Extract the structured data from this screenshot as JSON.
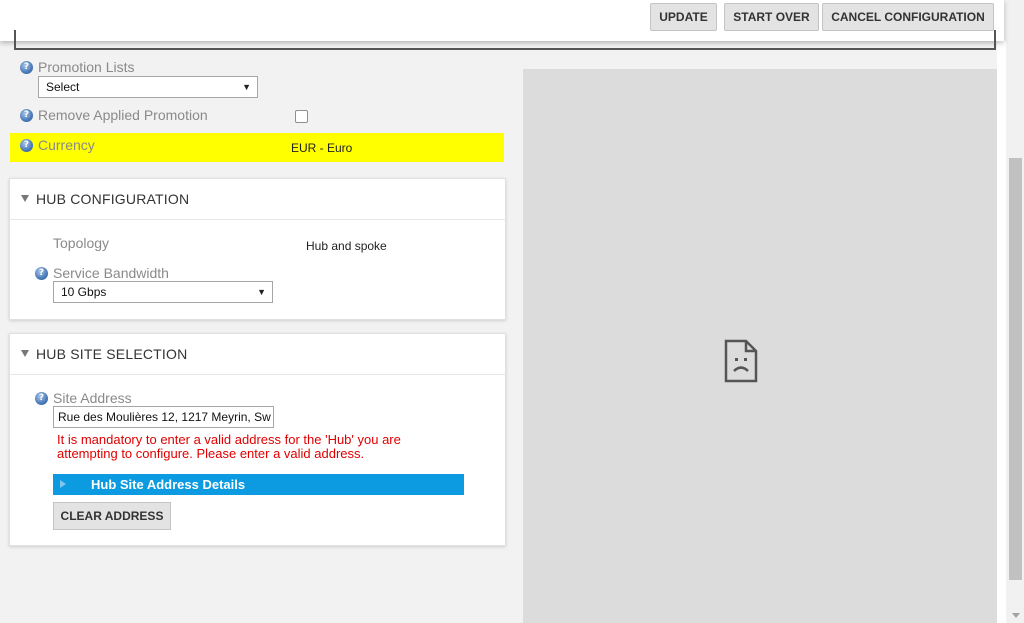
{
  "toolbar": {
    "update_label": "UPDATE",
    "start_over_label": "START OVER",
    "cancel_label": "CANCEL CONFIGURATION"
  },
  "promotion": {
    "promotion_lists_label": "Promotion Lists",
    "promotion_lists_value": "Select",
    "remove_applied_label": "Remove Applied Promotion",
    "remove_applied_checked": false
  },
  "currency": {
    "label": "Currency",
    "value": "EUR - Euro",
    "highlight_color": "#ffff00"
  },
  "hub_configuration": {
    "title": "HUB CONFIGURATION",
    "topology_label": "Topology",
    "topology_value": "Hub and spoke",
    "bandwidth_label": "Service Bandwidth",
    "bandwidth_value": "10 Gbps"
  },
  "hub_site_selection": {
    "title": "HUB SITE SELECTION",
    "site_address_label": "Site Address",
    "site_address_value": "Rue des Moulières 12, 1217 Meyrin, Sw",
    "error_line1": "It is mandatory to enter a valid address for the 'Hub' you are",
    "error_line2": "attempting to configure. Please enter a valid address.",
    "details_label": "Hub Site Address Details",
    "clear_address_label": "CLEAR ADDRESS",
    "error_color": "#e00000",
    "accent_color": "#0c9be0"
  },
  "icons": {
    "help": "help-icon",
    "dropdown": "chevron-down-icon",
    "collapse": "collapse-triangle-icon",
    "expand": "expand-triangle-icon",
    "broken_image": "broken-image-icon"
  }
}
